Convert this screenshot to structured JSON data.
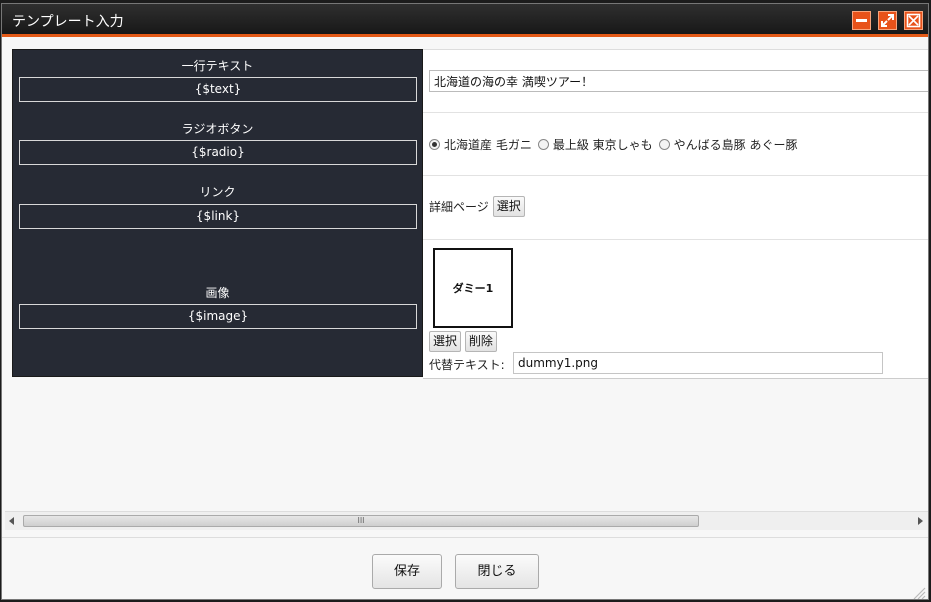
{
  "window": {
    "title": "テンプレート入力",
    "controls": {
      "minimize": "minimize-icon",
      "maximize": "maximize-icon",
      "close": "close-icon"
    },
    "accent": "#e45a17"
  },
  "fields": {
    "text": {
      "label": "一行テキスト",
      "variable": "{$text}",
      "value": "北海道の海の幸 満喫ツアー！"
    },
    "radio": {
      "label": "ラジオボタン",
      "variable": "{$radio}",
      "options": [
        "北海道産 毛ガニ",
        "最上級 東京しゃも",
        "やんばる島豚 あぐー豚"
      ],
      "selected": "北海道産 毛ガニ"
    },
    "link": {
      "label": "リンク",
      "variable": "{$link}",
      "value": "詳細ページ",
      "select_label": "選択"
    },
    "image": {
      "label": "画像",
      "variable": "{$image}",
      "thumbnail_text": "ダミー1",
      "select_label": "選択",
      "delete_label": "削除",
      "alt_label": "代替テキスト:",
      "alt_value": "dummy1.png"
    }
  },
  "scrollbar": {
    "thumb_grip": "III"
  },
  "footer": {
    "save_label": "保存",
    "close_label": "閉じる"
  }
}
